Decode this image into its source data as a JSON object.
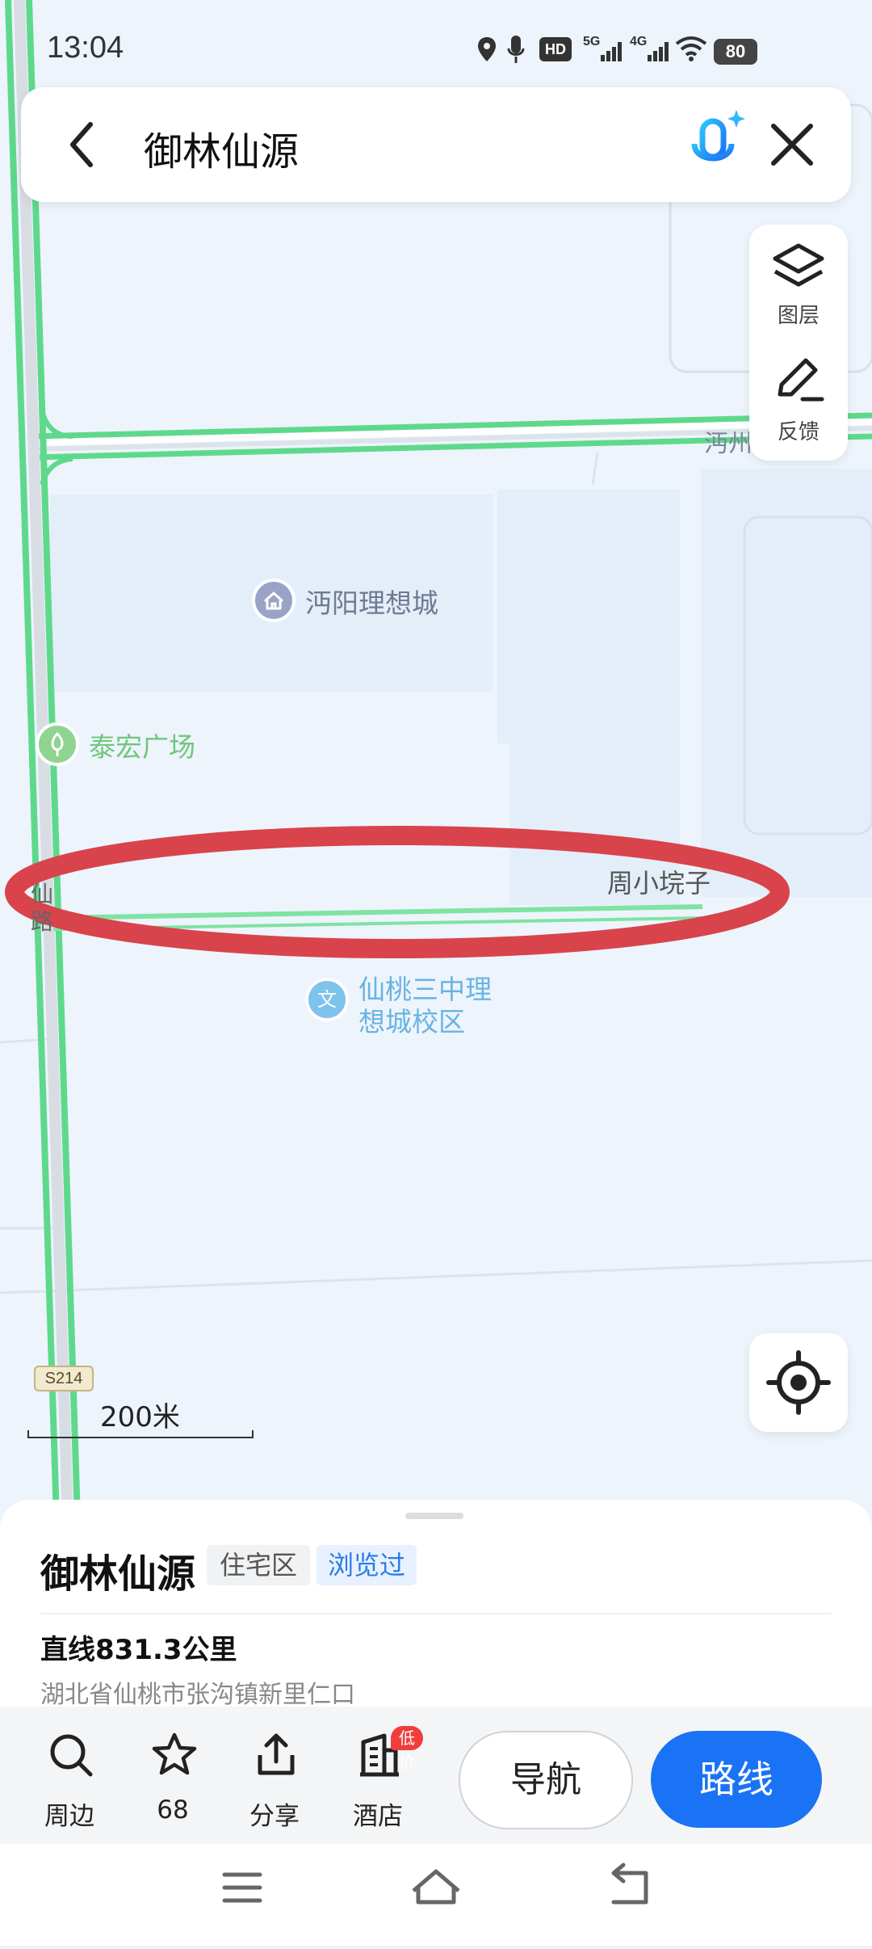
{
  "status_bar": {
    "time": "13:04",
    "battery": "80",
    "network_labels": [
      "HD",
      "5G",
      "4G"
    ]
  },
  "search": {
    "query": "御林仙源"
  },
  "tools": {
    "layers_label": "图层",
    "feedback_label": "反馈"
  },
  "map": {
    "labels": {
      "poi_1": "沔阳理想城",
      "poi_2": "泰宏广场",
      "poi_3_line1": "仙桃三中理",
      "poi_3_line2": "想城校区",
      "road_1": "沔州",
      "village": "周小垸子",
      "road_vertical": "仙 路"
    },
    "road_badge": "S214",
    "scale": "200米",
    "highlight_color": "#d9434b"
  },
  "place_card": {
    "name": "御林仙源",
    "type": "住宅区",
    "visited": "浏览过",
    "distance": "直线831.3公里",
    "address": "湖北省仙桃市张沟镇新里仁口"
  },
  "actions": {
    "nearby": "周边",
    "favorite_count": "68",
    "share": "分享",
    "hotel": "酒店",
    "hotel_badge": "低价",
    "navigate": "导航",
    "route": "路线"
  },
  "colors": {
    "accent": "#1a73f4",
    "road_green": "#5ed98b"
  }
}
